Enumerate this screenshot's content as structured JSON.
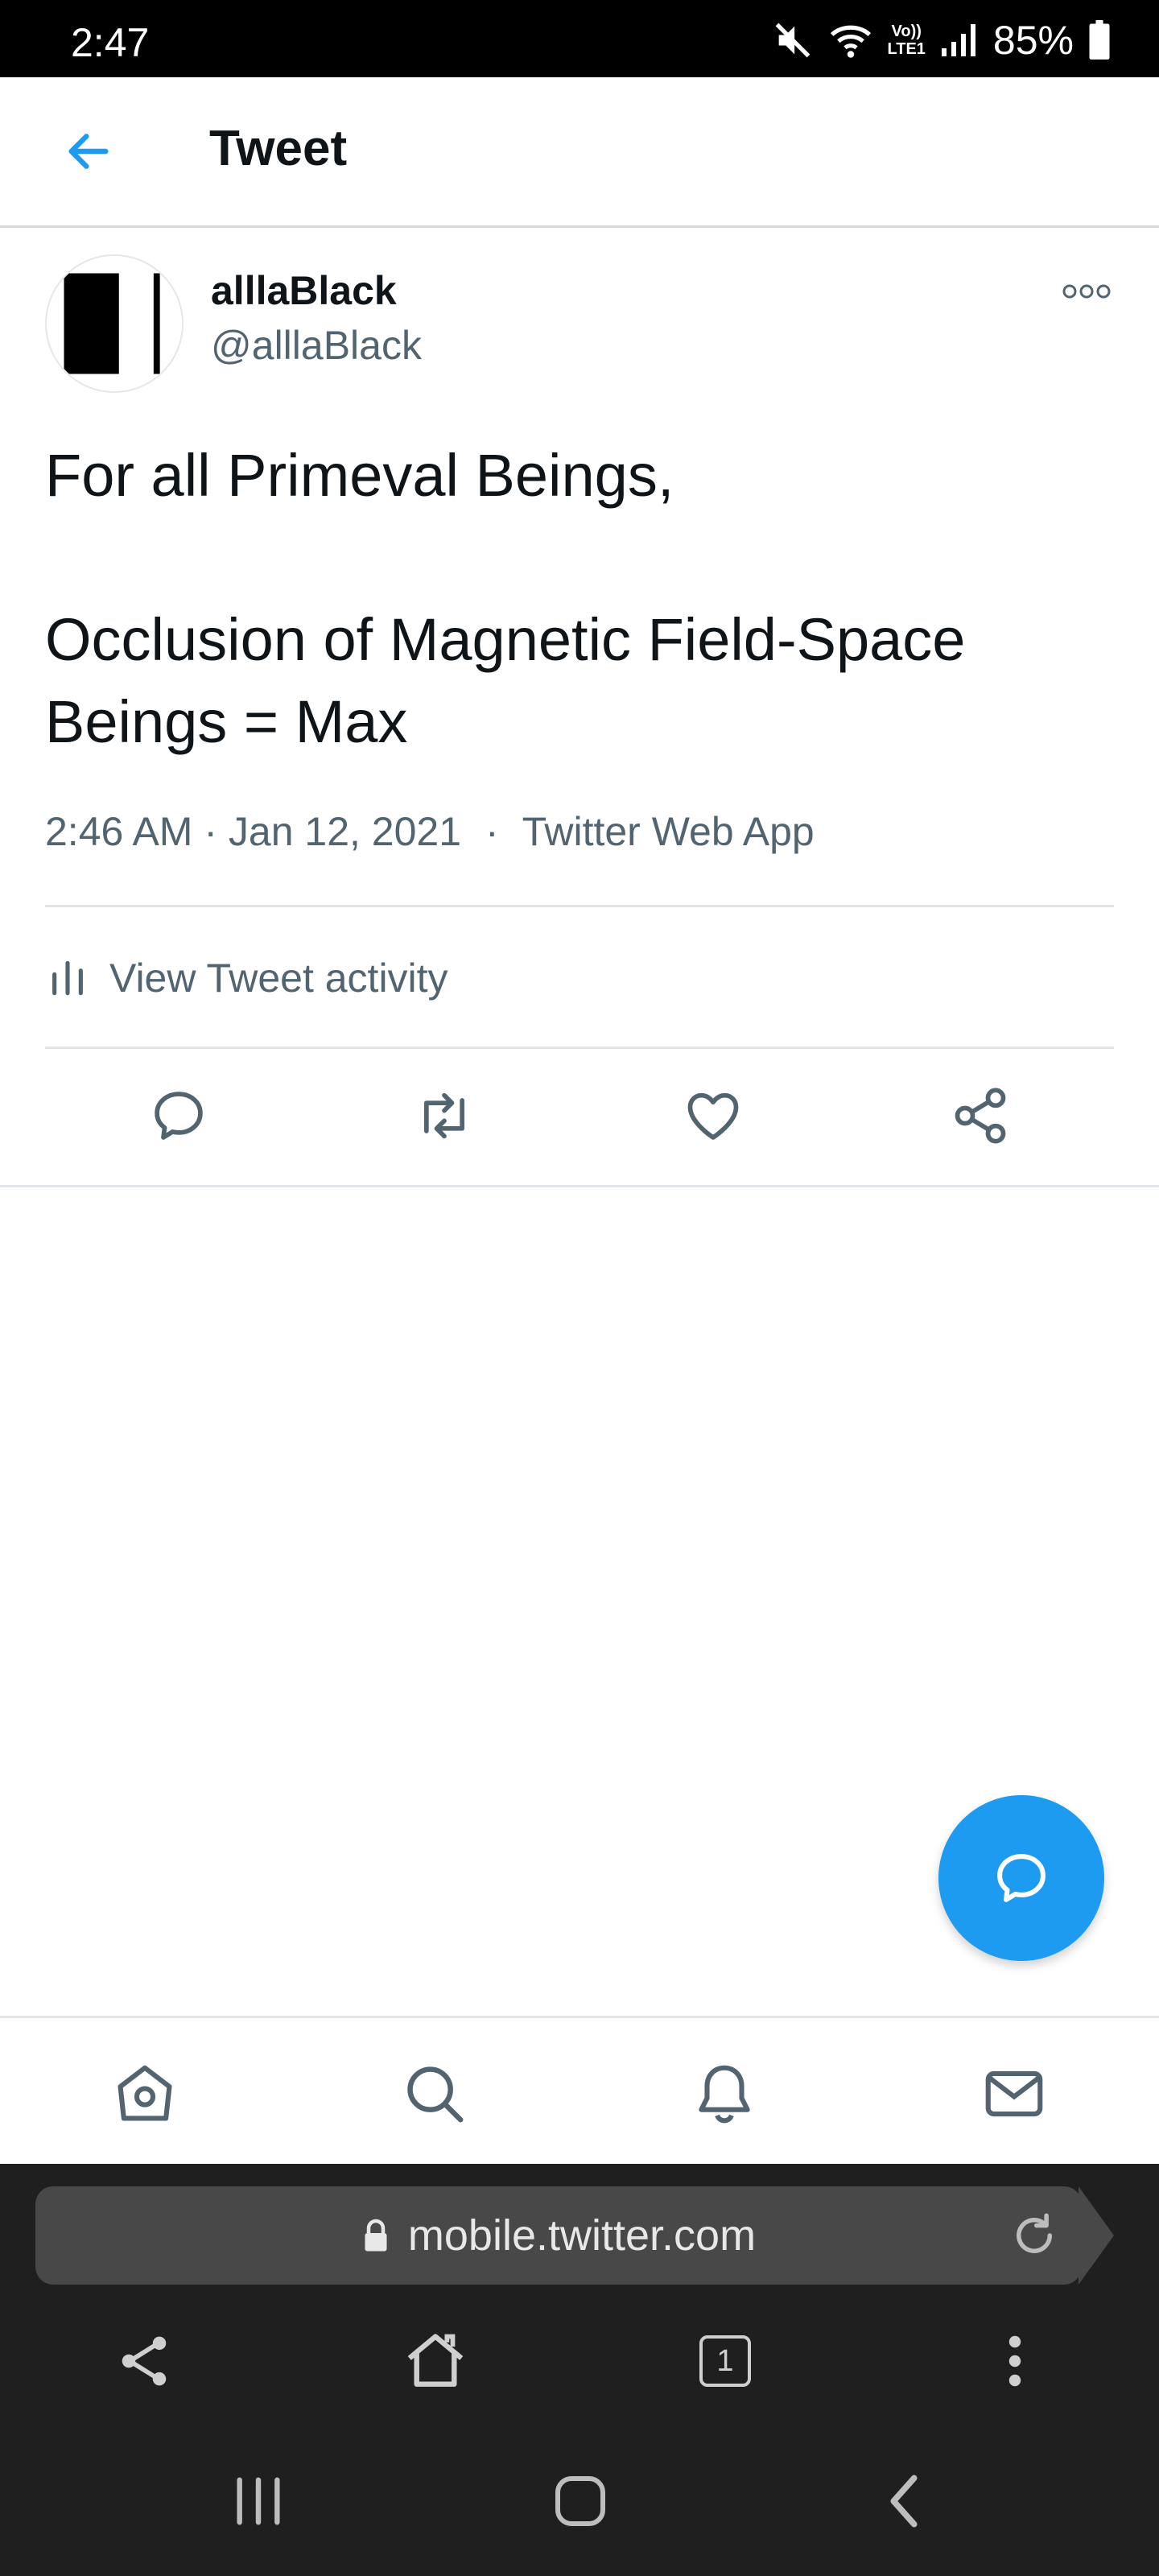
{
  "status_bar": {
    "time": "2:47",
    "battery": "85%",
    "icons": [
      "mute-icon",
      "wifi-icon",
      "volte-lte-icon",
      "signal-icon",
      "battery-icon"
    ],
    "volte_label": "Vo))",
    "lte_label": "LTE1"
  },
  "header": {
    "back_icon": "arrow-left-icon",
    "title": "Tweet"
  },
  "tweet": {
    "author_name": "alllaBlack",
    "author_handle": "@alllaBlack",
    "text": "For all Primeval Beings,\n\nOcclusion of Magnetic Field-Space Beings = Max",
    "timestamp": "2:46 AM · Jan 12, 2021",
    "separator": "·",
    "source": "Twitter Web App",
    "activity_label": "View Tweet activity",
    "actions": [
      "reply-icon",
      "retweet-icon",
      "like-icon",
      "share-icon"
    ]
  },
  "bottom_nav": [
    "home-icon",
    "search-icon",
    "notifications-icon",
    "messages-icon"
  ],
  "browser": {
    "url": "mobile.twitter.com",
    "tab_count": "1",
    "controls": [
      "share-icon",
      "home-icon",
      "tabs-icon",
      "menu-icon"
    ]
  },
  "system_nav": [
    "recents-icon",
    "home-icon",
    "back-icon"
  ],
  "colors": {
    "accent": "#1d9bf0",
    "text_primary": "#0f1419",
    "text_secondary": "#536471",
    "divider": "#e3e6e8",
    "browser_bg": "#1f1f1f",
    "url_pill": "#484848"
  }
}
